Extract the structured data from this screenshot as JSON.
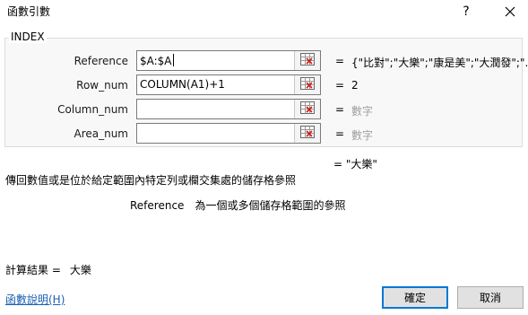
{
  "window": {
    "title": "函數引數",
    "help_label": "?"
  },
  "group": {
    "legend": "INDEX"
  },
  "args": [
    {
      "label": "Reference",
      "value": "$A:$A",
      "result": "{\"比對\";\"大樂\";\"康是美\";\"大潤發\";\"..."
    },
    {
      "label": "Row_num",
      "value": "COLUMN(A1)+1",
      "result": "2"
    },
    {
      "label": "Column_num",
      "value": "",
      "result": "數字"
    },
    {
      "label": "Area_num",
      "value": "",
      "result": "數字"
    }
  ],
  "equals_sign": "=",
  "formula_result": "=  \"大樂\"",
  "description": "傳回數值或是位於給定範圍內特定列或欄交集處的儲存格參照",
  "arg_description": {
    "name": "Reference",
    "text": "為一個或多個儲存格範圍的參照"
  },
  "calc_result": {
    "label": "計算結果 =",
    "value": "大樂"
  },
  "help_link": "函數說明(H)",
  "buttons": {
    "ok": "確定",
    "cancel": "取消"
  },
  "colors": {
    "accent": "#0078d7",
    "link": "#1a5fb4",
    "hint": "#a0a0a0"
  }
}
